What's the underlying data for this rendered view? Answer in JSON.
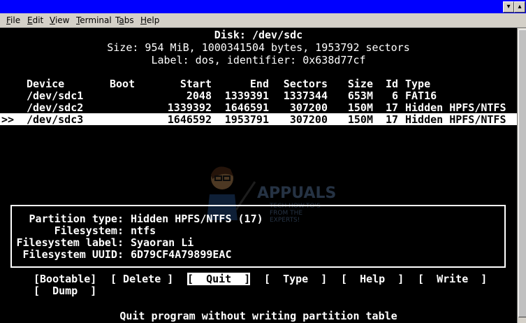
{
  "window": {
    "title_buttons": [
      "▾",
      "▴"
    ]
  },
  "menubar": {
    "items": [
      {
        "label": "File",
        "mnemonic": "F"
      },
      {
        "label": "Edit",
        "mnemonic": "E"
      },
      {
        "label": "View",
        "mnemonic": "V"
      },
      {
        "label": "Terminal",
        "mnemonic": "T"
      },
      {
        "label": "Tabs",
        "mnemonic": "a"
      },
      {
        "label": "Help",
        "mnemonic": "H"
      }
    ]
  },
  "disk": {
    "title": "Disk: /dev/sdc",
    "size_line": "Size: 954 MiB, 1000341504 bytes, 1953792 sectors",
    "label_line": "Label: dos, identifier: 0x638d77cf"
  },
  "table": {
    "headers": {
      "device": "Device",
      "boot": "Boot",
      "start": "Start",
      "end": "End",
      "sectors": "Sectors",
      "size": "Size",
      "id": "Id",
      "type": "Type"
    },
    "rows": [
      {
        "marker": "",
        "device": "/dev/sdc1",
        "boot": "",
        "start": "2048",
        "end": "1339391",
        "sectors": "1337344",
        "size": "653M",
        "id": "6",
        "type": "FAT16"
      },
      {
        "marker": "",
        "device": "/dev/sdc2",
        "boot": "",
        "start": "1339392",
        "end": "1646591",
        "sectors": "307200",
        "size": "150M",
        "id": "17",
        "type": "Hidden HPFS/NTFS"
      },
      {
        "marker": ">>",
        "device": "/dev/sdc3",
        "boot": "",
        "start": "1646592",
        "end": "1953791",
        "sectors": "307200",
        "size": "150M",
        "id": "17",
        "type": "Hidden HPFS/NTFS"
      }
    ]
  },
  "info": {
    "partition_type_label": "Partition type:",
    "partition_type_value": "Hidden HPFS/NTFS (17)",
    "filesystem_label": "Filesystem:",
    "filesystem_value": "ntfs",
    "fs_label_label": "Filesystem label:",
    "fs_label_value": "Syaoran Li",
    "fs_uuid_label": "Filesystem UUID:",
    "fs_uuid_value": "6D79CF4A79899EAC"
  },
  "watermark": {
    "brand": "APPUALS",
    "tagline": "TECH HOW-TO'S FROM THE EXPERTS!"
  },
  "actions": {
    "bootable": "[Bootable]",
    "delete": "[ Delete ]",
    "quit": "[  Quit  ]",
    "type": "[  Type  ]",
    "help": "[  Help  ]",
    "write": "[  Write  ]",
    "dump": "[  Dump  ]"
  },
  "status_text": "Quit program without writing partition table",
  "colors": {
    "titlebar": "#0000ff",
    "terminal_bg": "#000000",
    "terminal_fg": "#ffffff",
    "chrome": "#d4d0c8"
  }
}
